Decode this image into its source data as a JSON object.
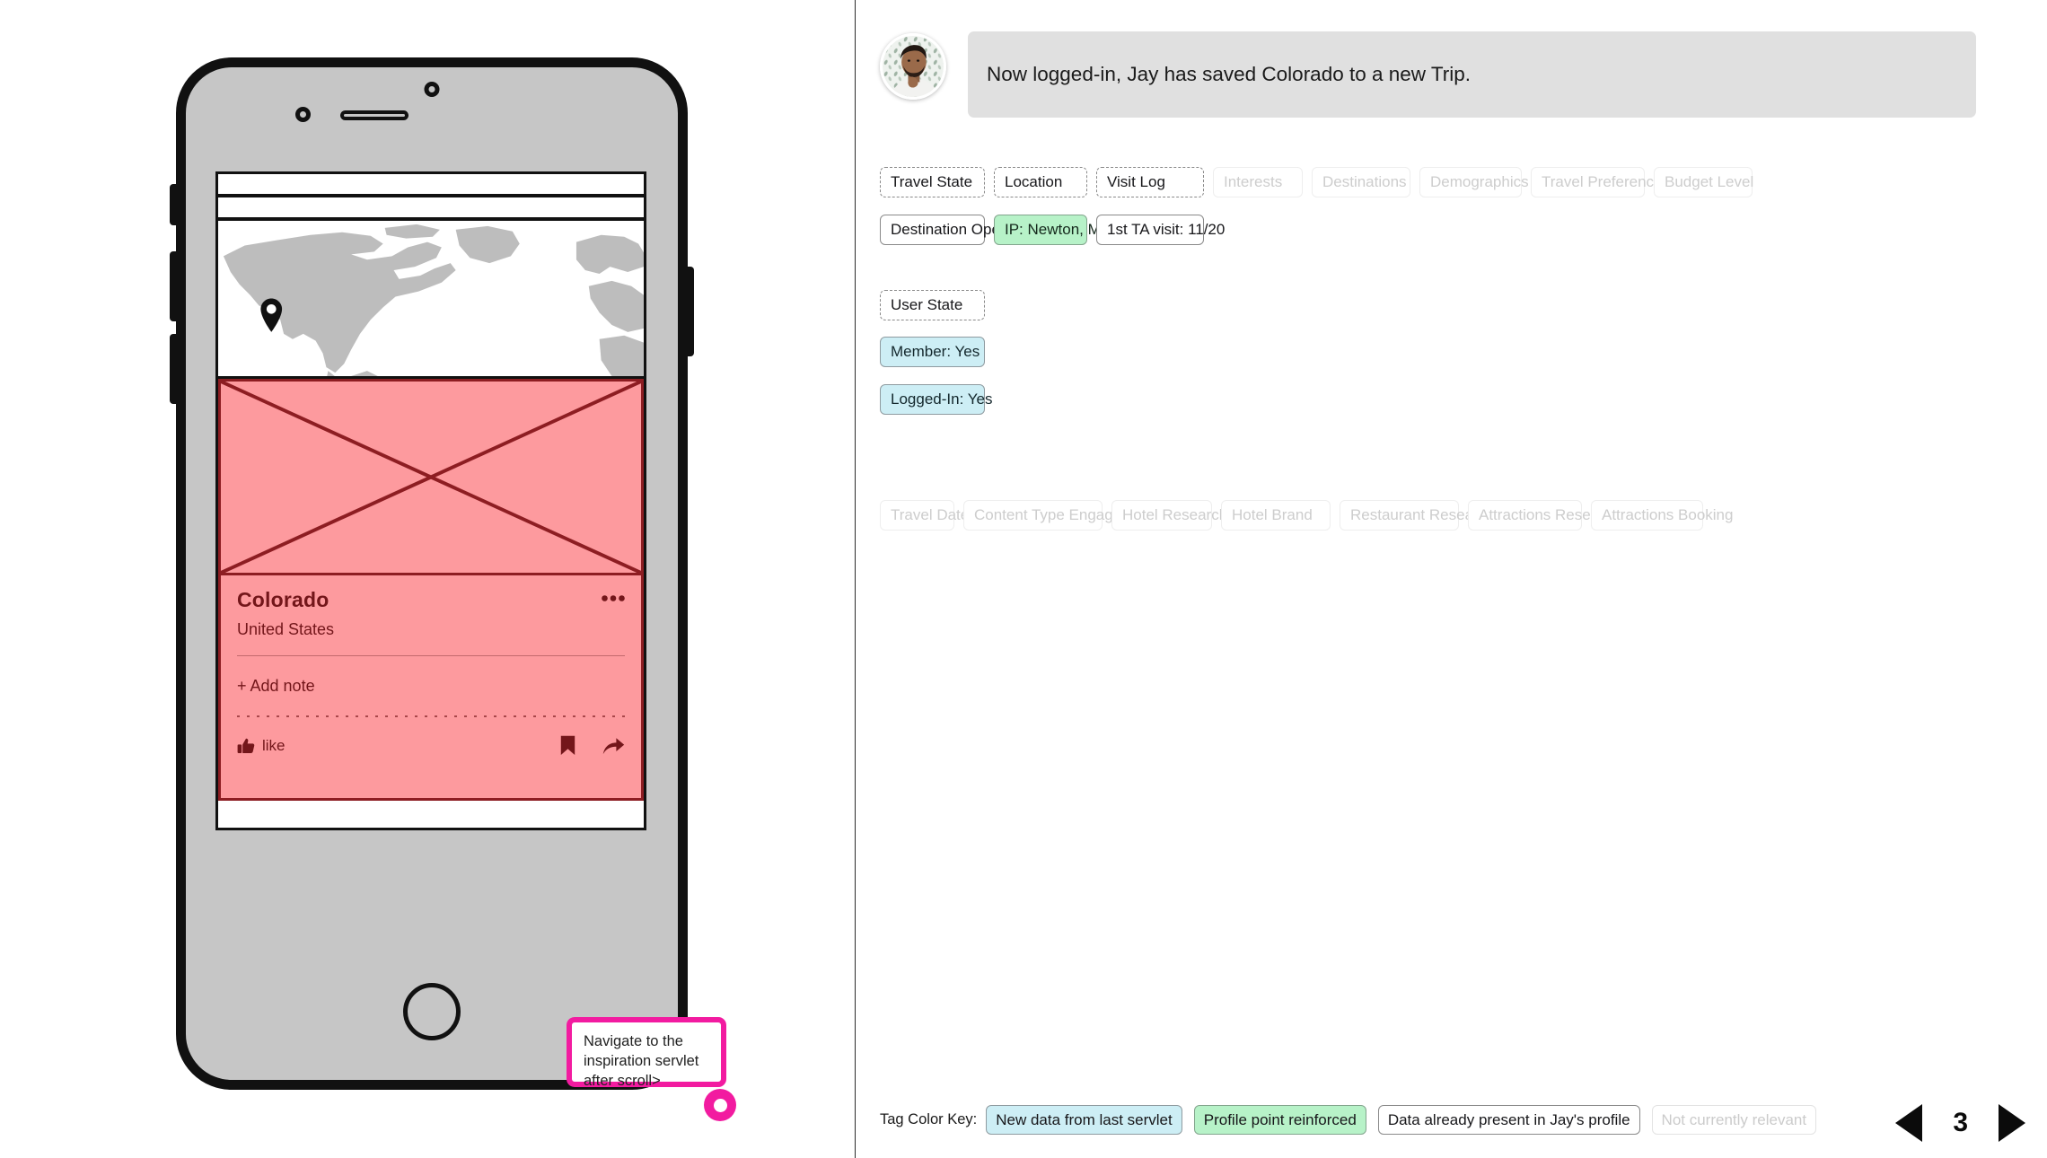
{
  "header": {
    "avatar_alt": "Jay profile photo",
    "message": "Now logged-in, Jay has saved Colorado to a new Trip."
  },
  "phone": {
    "map": {
      "pin_icon": "map-pin-icon",
      "region": "North America"
    },
    "card": {
      "title": "Colorado",
      "country": "United States",
      "add_note": "+ Add note",
      "like_label": "like",
      "overflow_icon": "more-options-icon",
      "like_icon": "thumbs-up-icon",
      "save_icon": "bookmark-icon",
      "share_icon": "share-icon"
    }
  },
  "callout": {
    "text": "Navigate to the inspiration servlet after scroll>",
    "cursor_icon": "click-target-icon"
  },
  "tag_groups": [
    {
      "name": "row-1-categories",
      "tags": [
        {
          "label": "Travel State",
          "style": "cat",
          "width": "w-travel-state"
        },
        {
          "label": "Location",
          "style": "cat",
          "width": "w-location"
        },
        {
          "label": "Visit Log",
          "style": "cat",
          "width": "w-visitlog"
        },
        {
          "label": "Interests",
          "style": "faded",
          "width": "w-interests"
        },
        {
          "label": "Destinations",
          "style": "faded",
          "width": "w-destinations"
        },
        {
          "label": "Demographics",
          "style": "faded",
          "width": "w-demographics"
        },
        {
          "label": "Travel Preference",
          "style": "faded",
          "width": "w-travelpref"
        },
        {
          "label": "Budget Level",
          "style": "faded",
          "width": "w-budget"
        }
      ]
    },
    {
      "name": "row-2-values",
      "tags": [
        {
          "label": "Destination Open",
          "style": "plain",
          "width": "w-destopen"
        },
        {
          "label": "IP: Newton, MA",
          "style": "green",
          "width": "w-ip"
        },
        {
          "label": "1st TA visit: 11/20",
          "style": "plain",
          "width": "w-ta"
        }
      ]
    },
    {
      "name": "user-state-category",
      "tags": [
        {
          "label": "User State",
          "style": "cat",
          "width": "w-userstate"
        }
      ]
    },
    {
      "name": "user-state-value-member",
      "tags": [
        {
          "label": "Member: Yes",
          "style": "blue",
          "width": "w-member"
        }
      ]
    },
    {
      "name": "user-state-value-login",
      "tags": [
        {
          "label": "Logged-In: Yes",
          "style": "blue",
          "width": "w-login"
        }
      ]
    },
    {
      "name": "row-3-faded-categories",
      "tags": [
        {
          "label": "Travel Dates",
          "style": "faded",
          "width": "w-tdates"
        },
        {
          "label": "Content Type Engagement",
          "style": "faded",
          "width": "w-cte"
        },
        {
          "label": "Hotel Research",
          "style": "faded",
          "width": "w-hresearch"
        },
        {
          "label": "Hotel Brand",
          "style": "faded",
          "width": "w-hbrand"
        },
        {
          "label": "Restaurant Research",
          "style": "faded",
          "width": "w-rresearch"
        },
        {
          "label": "Attractions Research",
          "style": "faded",
          "width": "w-aresearch"
        },
        {
          "label": "Attractions Booking",
          "style": "faded",
          "width": "w-abooking"
        }
      ]
    }
  ],
  "footer": {
    "key_label": "Tag Color Key:",
    "keys": [
      {
        "label": "New data from last servlet",
        "style": "blue"
      },
      {
        "label": "Profile point reinforced",
        "style": "green"
      },
      {
        "label": "Data already present in Jay's profile",
        "style": ""
      },
      {
        "label": "Not currently relevant",
        "style": "grey"
      }
    ]
  },
  "pager": {
    "prev_icon": "triangle-left-icon",
    "next_icon": "triangle-right-icon",
    "page": "3"
  },
  "colors": {
    "accent_pink": "#f21ba0",
    "card_fill": "#fd9a9e",
    "card_stroke": "#8d1d22",
    "tag_blue": "#cdeef5",
    "tag_green": "#b7f2c8",
    "message_bg": "#e0e0e0",
    "phone_body": "#c6c6c6"
  }
}
